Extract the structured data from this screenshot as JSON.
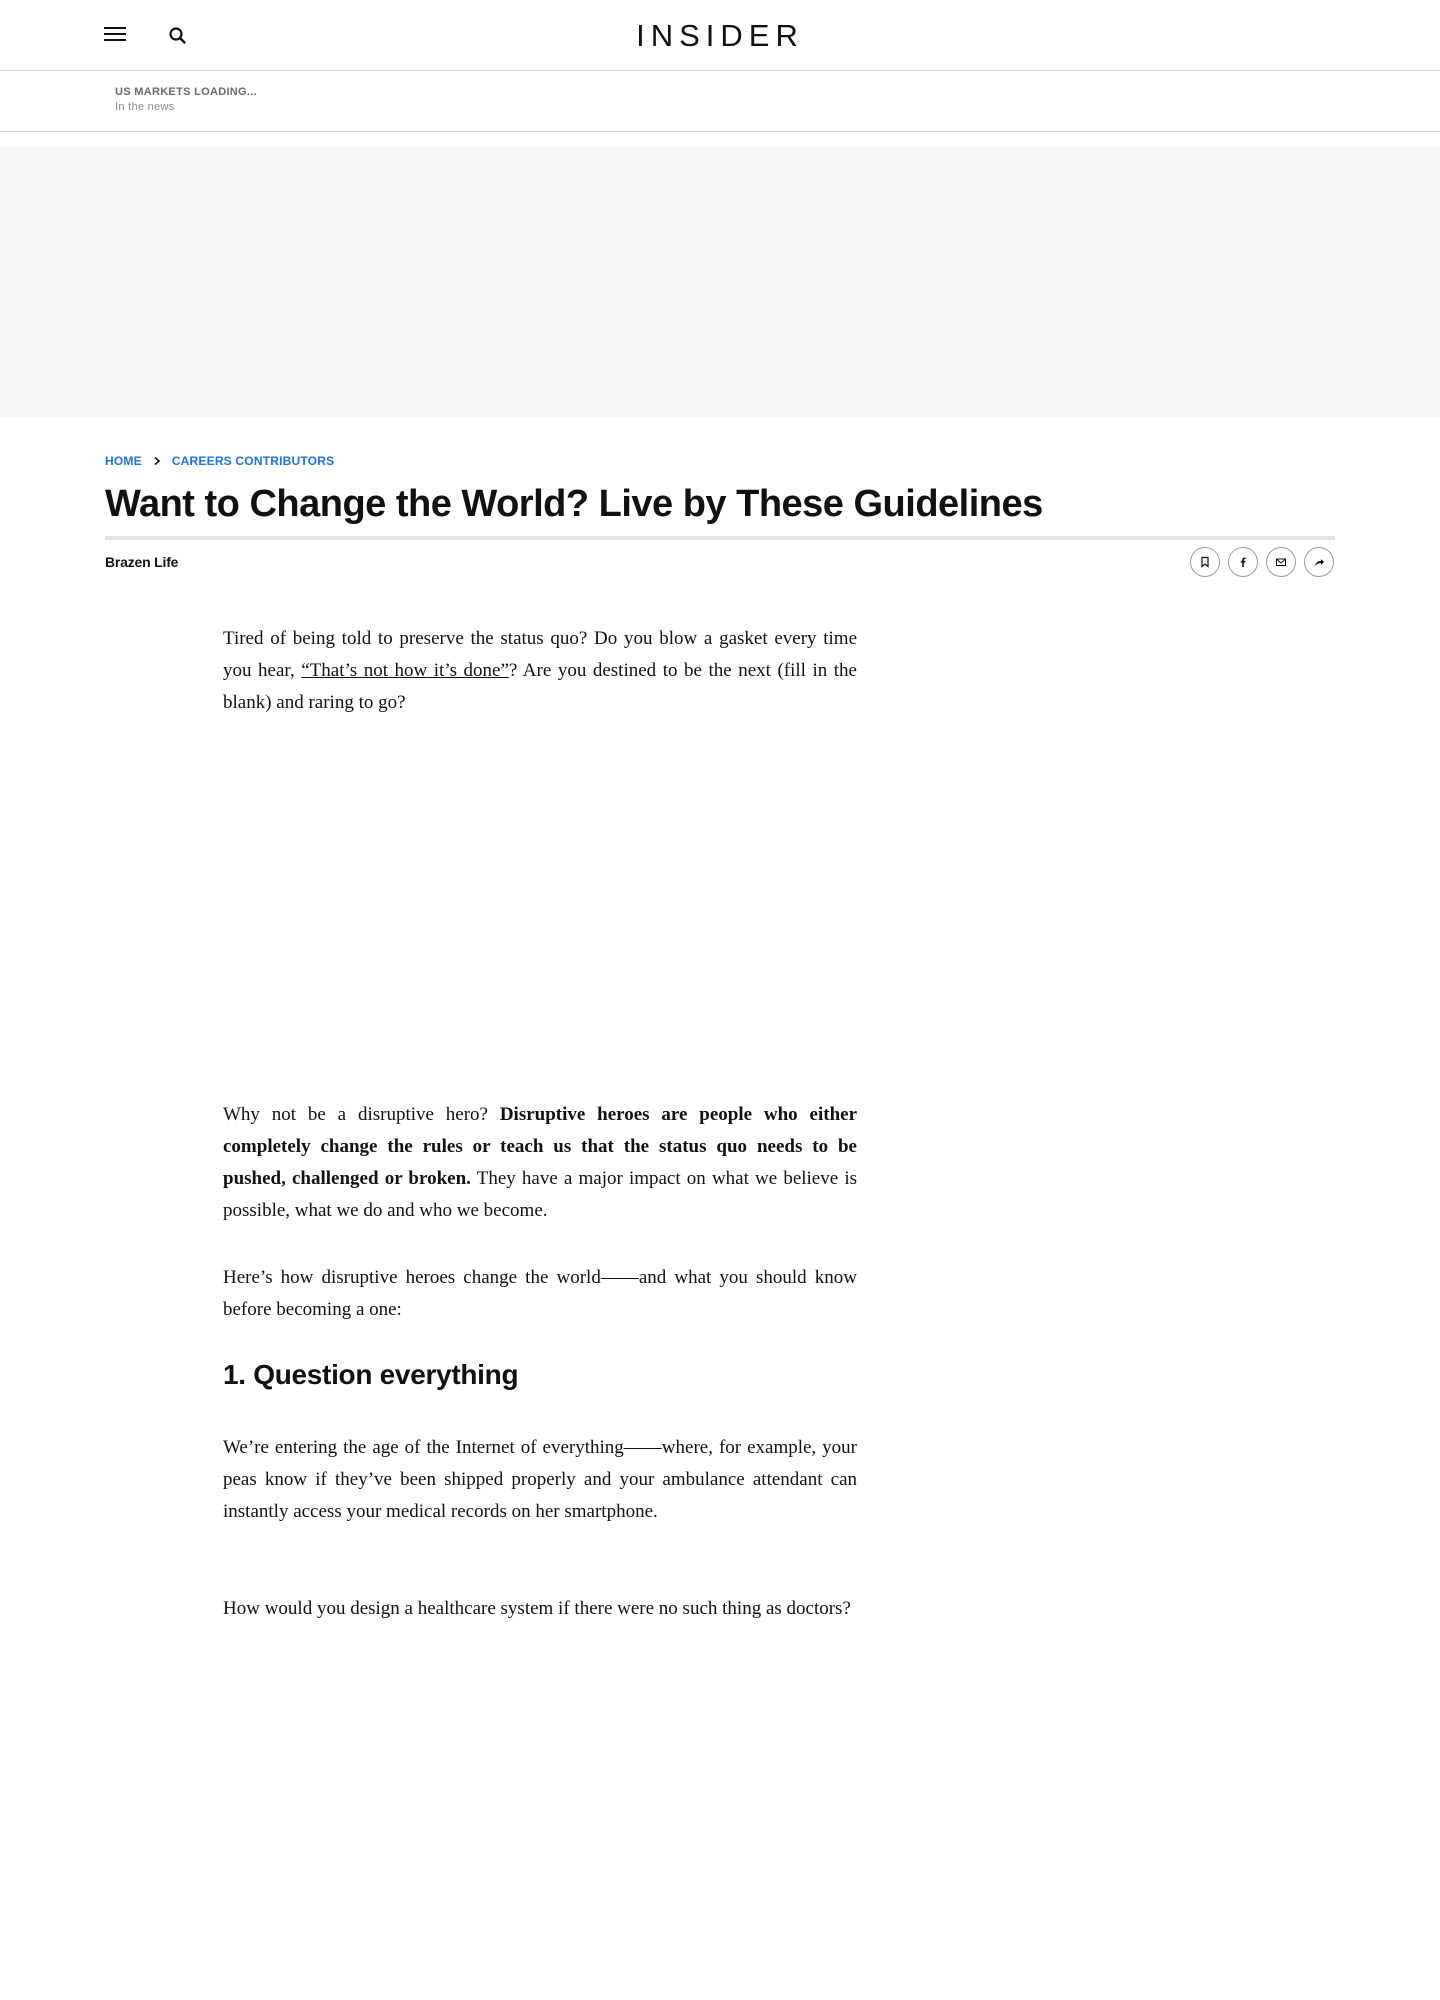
{
  "header": {
    "logo": "INSIDER",
    "menu_icon": "hamburger-menu-icon",
    "search_icon": "search-icon"
  },
  "markets": {
    "status": "US MARKETS LOADING...",
    "subtitle": "In the news"
  },
  "breadcrumb": {
    "home": "HOME",
    "section": "CAREERS CONTRIBUTORS"
  },
  "article": {
    "title": "Want to Change the World? Live by These Guidelines",
    "byline": "Brazen Life",
    "p1": {
      "before": "Tired of being told to preserve the status quo? Do you blow a gasket every time you hear, ",
      "link": "“That’s not how it’s done”",
      "after": "? Are you destined to be the next (fill in the blank) and raring to go?"
    },
    "p2": {
      "before": "Why not be a disruptive hero? ",
      "bold": "Disruptive heroes are people who either completely change the rules or teach us that the status quo needs to be pushed, challenged or broken.",
      "after": " They have a major impact on what we believe is possible, what we do and who we become."
    },
    "p3": "Here’s how disruptive heroes change the world——and what you should know before becoming a one:",
    "h2": "1. Question everything",
    "p4": "We’re entering the age of the Internet of everything——where, for example, your peas know if they’ve been shipped properly and your ambulance attendant can instantly access your medical records on her smartphone.",
    "p5": "How would you design a healthcare system if there were no such thing as doctors?"
  },
  "share": {
    "icons": [
      "bookmark-icon",
      "facebook-icon",
      "email-icon",
      "share-icon"
    ]
  },
  "colors": {
    "link_blue": "#1a73e8",
    "ad_background": "#f6f7f7",
    "rule_gray": "#e4e4e4"
  }
}
